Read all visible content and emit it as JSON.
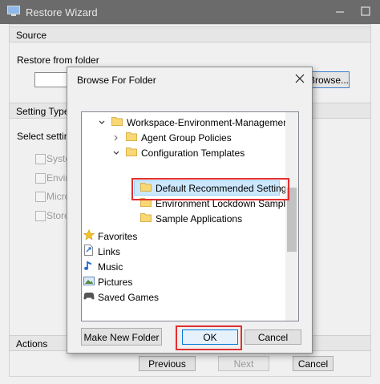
{
  "wizard": {
    "title": "Restore Wizard",
    "source_section": "Source",
    "restore_from_label": "Restore from folder",
    "browse_label": "Browse...",
    "setting_type_section": "Setting Type S",
    "select_label": "Select setting",
    "checkboxes": [
      "Syste",
      "Enviro",
      "Micros",
      "Storef"
    ],
    "actions_section": "Actions",
    "previous_label": "Previous",
    "next_label": "Next",
    "cancel_label": "Cancel"
  },
  "dialog": {
    "title": "Browse For Folder",
    "tree": {
      "root": "Workspace-Environment-Management",
      "agent_group": "Agent Group Policies",
      "config_templates": "Configuration Templates",
      "default_settings": "Default Recommended Settings",
      "env_lockdown": "Environment Lockdown Sample",
      "sample_apps": "Sample Applications",
      "favorites": "Favorites",
      "links": "Links",
      "music": "Music",
      "pictures": "Pictures",
      "saved_games": "Saved Games"
    },
    "make_folder_label": "Make New Folder",
    "ok_label": "OK",
    "cancel_label": "Cancel"
  },
  "colors": {
    "highlight": "#e03030",
    "selection": "#cce8ff",
    "accent": "#0078d7",
    "folder": "#f8d775"
  }
}
